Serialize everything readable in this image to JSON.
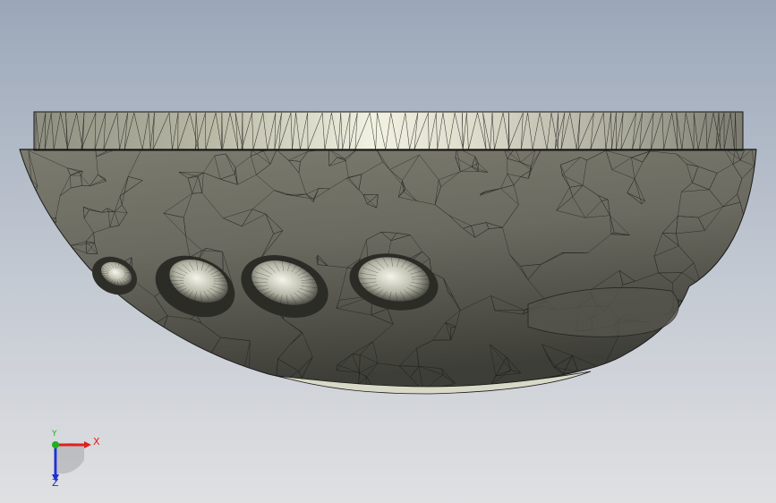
{
  "triad": {
    "x_label": "X",
    "y_label": "Y",
    "z_label": "Z",
    "x_color": "#e02020",
    "y_color": "#20b020",
    "z_color": "#2030d0"
  },
  "model": {
    "render_mode": "wireframe-mesh",
    "body_color": "#6e6e64",
    "rim_color": "#d8d8c4",
    "mesh_color": "#1a1a1a",
    "hole_count": 4
  }
}
